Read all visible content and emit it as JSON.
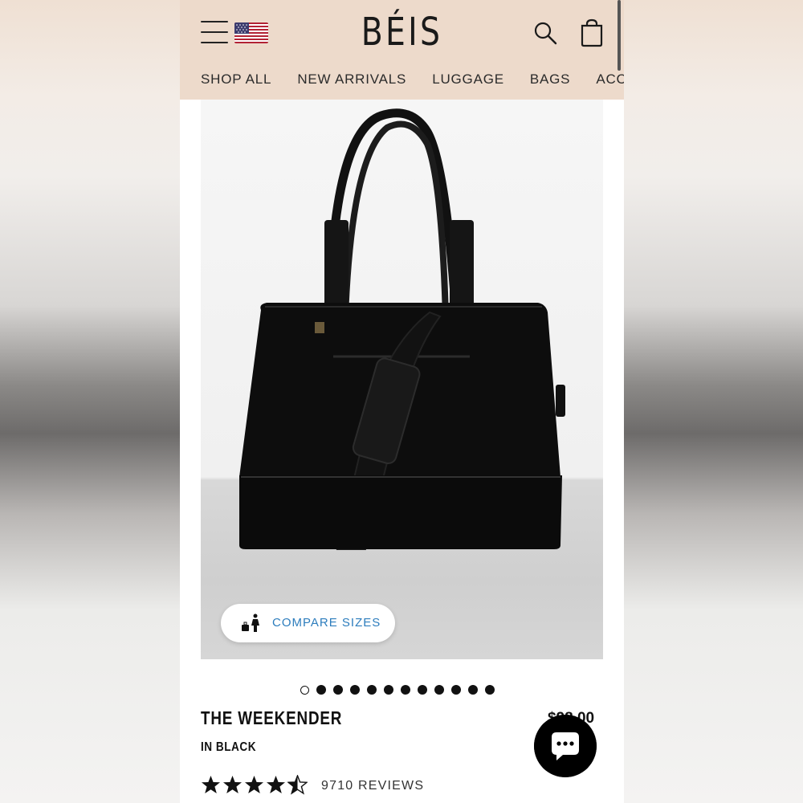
{
  "header": {
    "logo": "BÉIS",
    "nav_items": [
      "SHOP ALL",
      "NEW ARRIVALS",
      "LUGGAGE",
      "BAGS",
      "ACCESSORIES"
    ]
  },
  "product": {
    "compare_label": "COMPARE SIZES",
    "title": "THE WEEKENDER",
    "color_label": "IN BLACK",
    "price": "$98.00",
    "rating": 4.5,
    "reviews_label": "9710 REVIEWS",
    "carousel": {
      "total": 12,
      "active_index": 0
    }
  },
  "colors": {
    "header_bg": "#eddacb",
    "link_blue": "#2d7dbd",
    "text_dark": "#111111"
  },
  "icons": [
    "menu-icon",
    "us-flag-icon",
    "search-icon",
    "cart-icon",
    "size-compare-icon",
    "star-icon",
    "chat-icon"
  ]
}
